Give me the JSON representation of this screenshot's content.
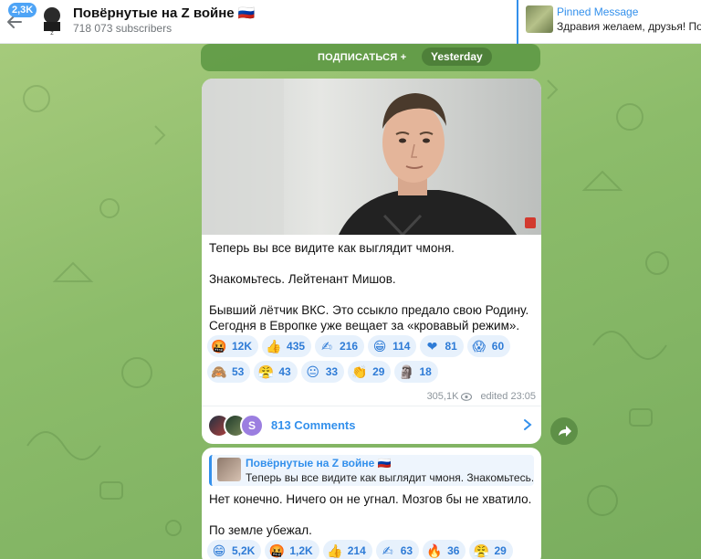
{
  "header": {
    "unread_badge": "2,3K",
    "title": "Повёрнутые на Z войне 🇷🇺",
    "subscribers": "718 073 subscribers",
    "pinned_label": "Pinned Message",
    "pinned_text": "Здравия желаем, друзья! По..."
  },
  "feed": {
    "subscribe_label": "ПОДПИСАТЬСЯ +",
    "date_label": "Yesterday"
  },
  "post": {
    "lines": [
      "Теперь вы все видите как выглядит чмоня.",
      "Знакомьтесь. Лейтенант Мишов.",
      "Бывший лётчик ВКС. Это ссыкло предало свою Родину.",
      "Сегодня в Европке уже вещает за «кровавый режим»."
    ],
    "reactions_row1": [
      {
        "emoji": "🤬",
        "count": "12K"
      },
      {
        "emoji": "👍",
        "count": "435"
      },
      {
        "emoji": "✍",
        "count": "216"
      },
      {
        "emoji": "😁",
        "count": "114"
      },
      {
        "emoji": "❤",
        "count": "81"
      },
      {
        "emoji": "😱",
        "count": "60"
      }
    ],
    "reactions_row2": [
      {
        "emoji": "🙈",
        "count": "53"
      },
      {
        "emoji": "😤",
        "count": "43"
      },
      {
        "emoji": "😐",
        "count": "33"
      },
      {
        "emoji": "👏",
        "count": "29"
      },
      {
        "emoji": "🗿",
        "count": "18"
      }
    ],
    "views": "305,1K",
    "edited": "edited 23:05",
    "comments_label": "813 Comments",
    "commenter_avatar_letter": "S"
  },
  "post2": {
    "quote_title": "Повёрнутые на Z войне 🇷🇺",
    "quote_text": "Теперь вы все видите как выглядит чмоня. Знакомьтесь. ...",
    "line1": "Нет конечно. Ничего он не угнал. Мозгов бы не хватило.",
    "line2": "По земле убежал.",
    "reactions": [
      {
        "emoji": "😁",
        "count": "5,2K"
      },
      {
        "emoji": "🤬",
        "count": "1,2K"
      },
      {
        "emoji": "👍",
        "count": "214"
      },
      {
        "emoji": "✍",
        "count": "63"
      },
      {
        "emoji": "🔥",
        "count": "36"
      },
      {
        "emoji": "😤",
        "count": "29"
      }
    ]
  },
  "colors": {
    "accent": "#3390ec",
    "chip_bg": "#e7f1fc",
    "chat_bg": "#8cbc6a"
  }
}
